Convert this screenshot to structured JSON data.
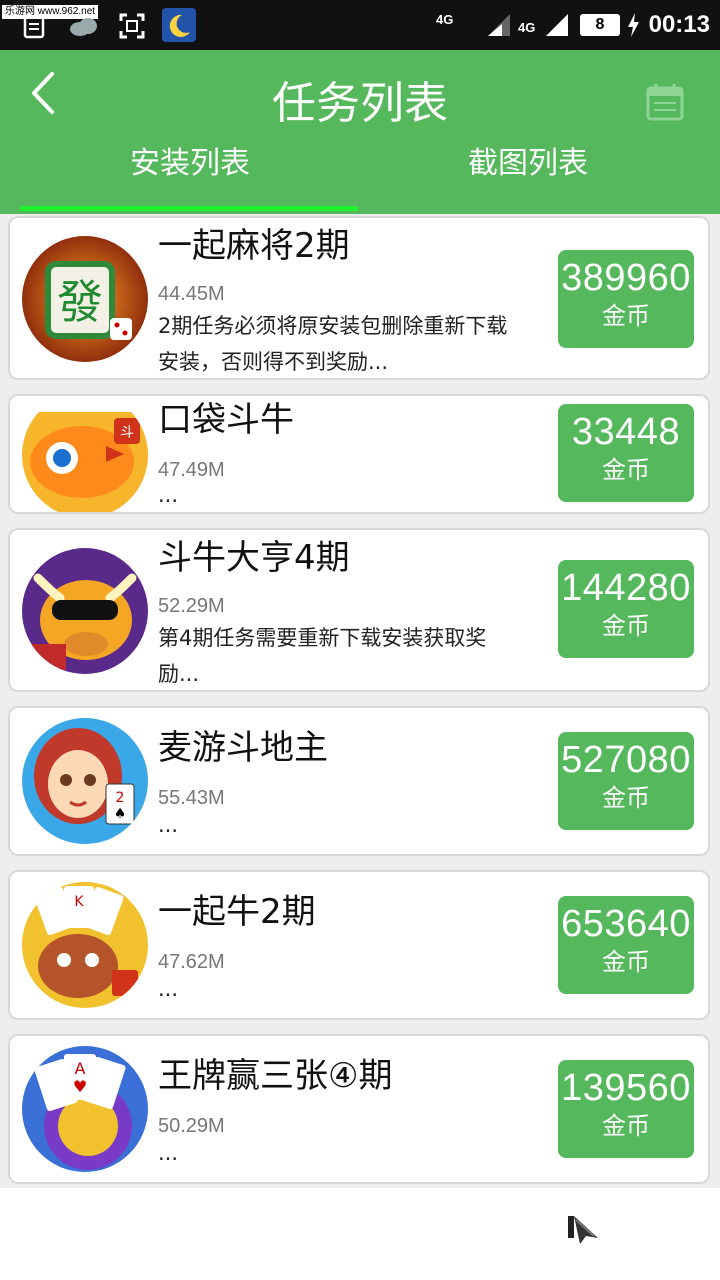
{
  "status_bar": {
    "watermark": "乐游网 www.962.net",
    "network_1": "4G",
    "network_2": "4G",
    "battery": "8",
    "time": "00:13"
  },
  "header": {
    "title": "任务列表",
    "tabs": [
      {
        "label": "安装列表",
        "active": true
      },
      {
        "label": "截图列表",
        "active": false
      }
    ]
  },
  "colors": {
    "primary": "#55b85d",
    "tab_indicator": "#1ef22e"
  },
  "tasks": [
    {
      "name": "一起麻将2期",
      "size": "44.45M",
      "desc_line1": "2期任务必须将原安装包删除重新下载",
      "desc_line2": "安装，否则得不到奖励...",
      "reward": "389960",
      "unit": "金币",
      "icon": "mahjong-icon"
    },
    {
      "name": "口袋斗牛",
      "size": "47.49M",
      "desc_line1": "...",
      "reward": "33448",
      "unit": "金币",
      "icon": "fish-icon"
    },
    {
      "name": "斗牛大亨4期",
      "size": "52.29M",
      "desc_line1": "第4期任务需要重新下载安装获取奖",
      "desc_line2": "励...",
      "reward": "144280",
      "unit": "金币",
      "icon": "bull-icon"
    },
    {
      "name": "麦游斗地主",
      "size": "55.43M",
      "desc_line1": "...",
      "reward": "527080",
      "unit": "金币",
      "icon": "girl-cards-icon"
    },
    {
      "name": "一起牛2期",
      "size": "47.62M",
      "desc_line1": "...",
      "reward": "653640",
      "unit": "金币",
      "icon": "bull-cards-icon"
    },
    {
      "name": "王牌赢三张④期",
      "size": "50.29M",
      "desc_line1": "...",
      "reward": "139560",
      "unit": "金币",
      "icon": "aces-icon"
    }
  ]
}
